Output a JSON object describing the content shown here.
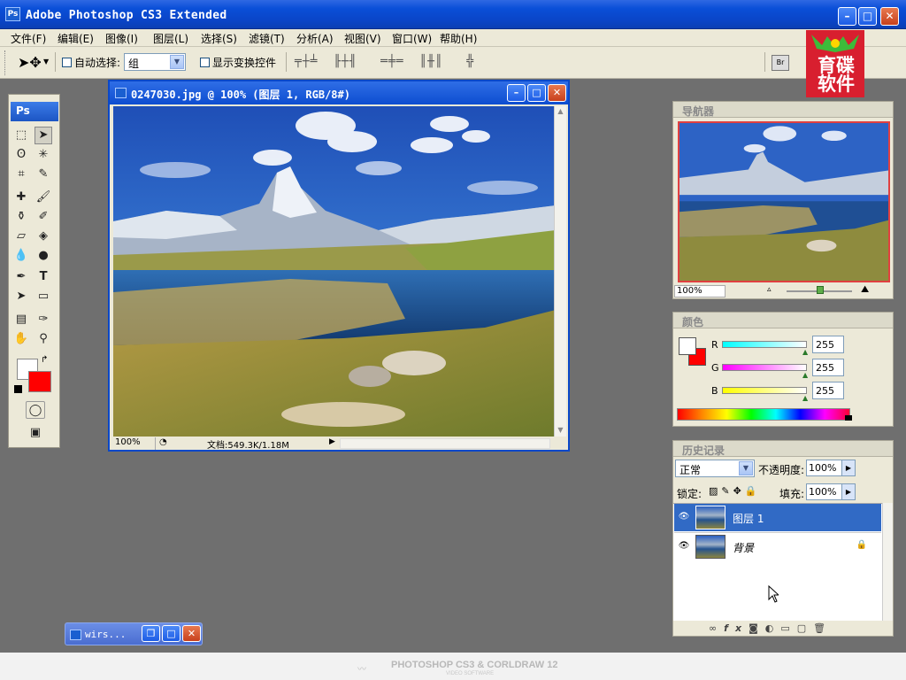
{
  "app": {
    "title": "Adobe Photoshop CS3 Extended",
    "badge": "Ps"
  },
  "menu": [
    "文件(F)",
    "编辑(E)",
    "图像(I)",
    "图层(L)",
    "选择(S)",
    "滤镜(T)",
    "分析(A)",
    "视图(V)",
    "窗口(W)",
    "帮助(H)"
  ],
  "options": {
    "auto_select_label": "自动选择:",
    "auto_select_value": "组",
    "show_transform_label": "显示变换控件"
  },
  "tools": {
    "header": "Ps"
  },
  "document": {
    "title": "0247030.jpg @ 100% (图层 1, RGB/8#)",
    "zoom": "100%",
    "doc_info": "文档:549.3K/1.18M"
  },
  "navigator": {
    "title": "导航器",
    "zoom": "100%"
  },
  "color": {
    "title": "颜色",
    "r_label": "R",
    "g_label": "G",
    "b_label": "B",
    "r": "255",
    "g": "255",
    "b": "255"
  },
  "history": {
    "title": "历史记录",
    "blend_mode": "正常",
    "opacity_label": "不透明度:",
    "opacity": "100%",
    "lock_label": "锁定:",
    "fill_label": "填充:",
    "fill": "100%",
    "layers": [
      {
        "name": "图层 1",
        "selected": true
      },
      {
        "name": "背景",
        "selected": false
      }
    ]
  },
  "minimized": {
    "title": "wirs..."
  },
  "logo": {
    "text": "育碟软件"
  },
  "footer": {
    "brand": "PHOTOSHOP CS3 & CORLDRAW 12",
    "sub": "VIDEO SOFTWARE"
  },
  "colors": {
    "accent": "#0a4fd8",
    "selected_layer": "#316ac5",
    "background_color_swatch": "#ff0000"
  }
}
